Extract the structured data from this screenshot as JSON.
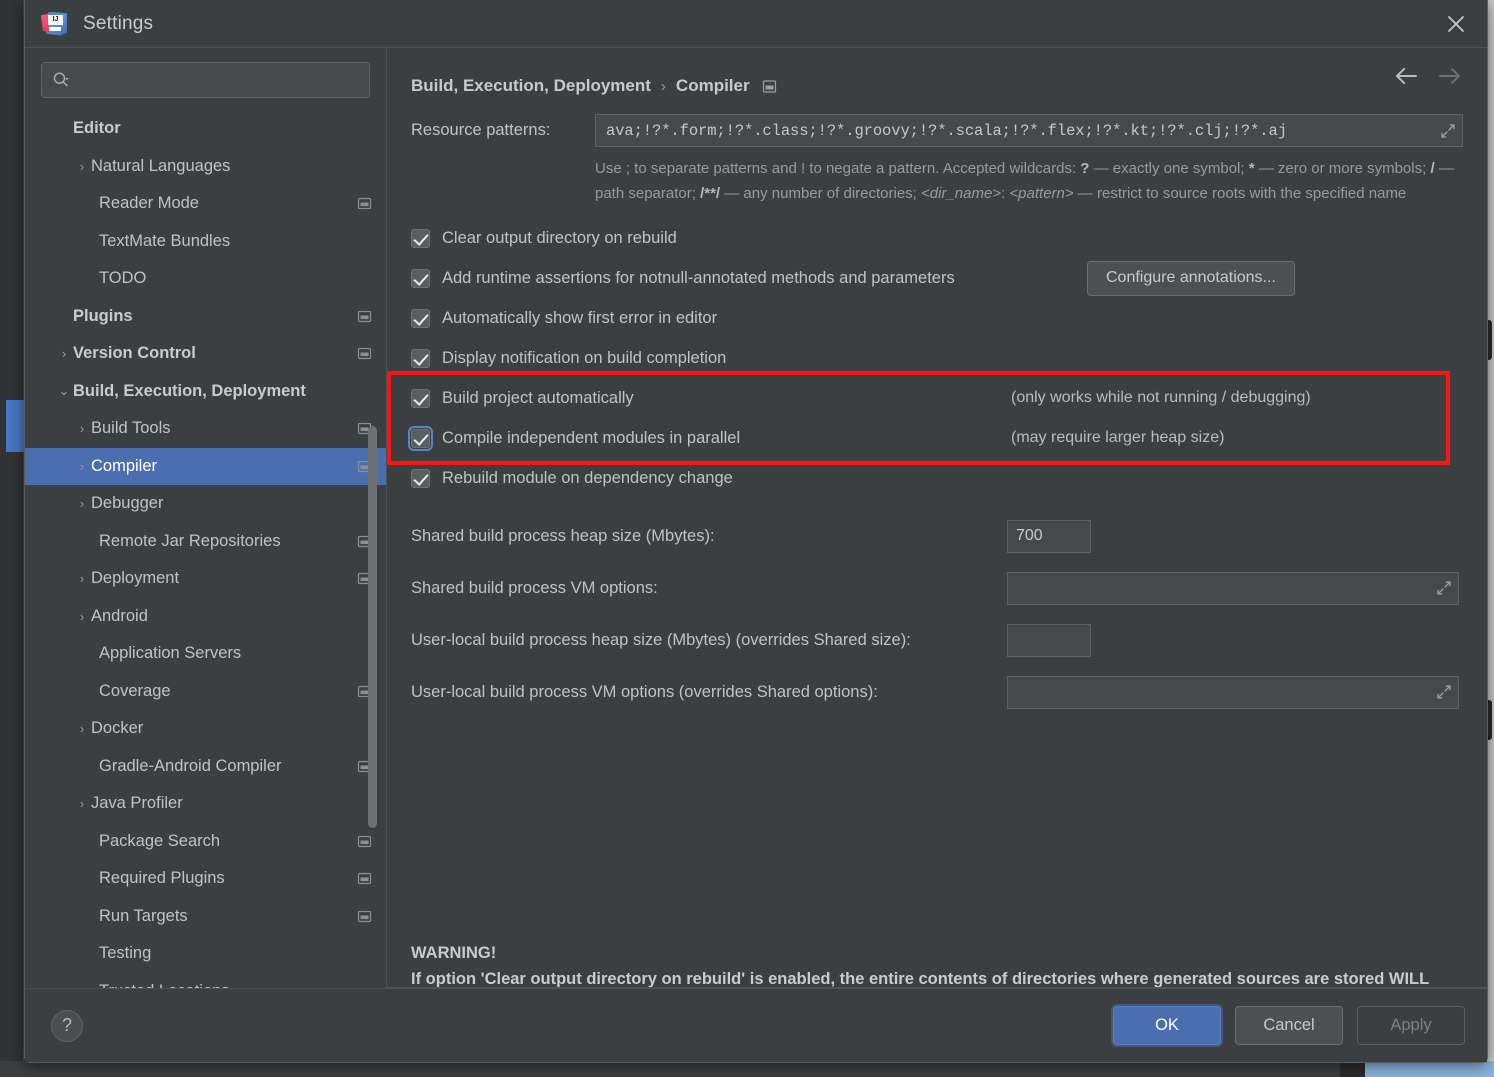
{
  "window": {
    "title": "Settings",
    "logo_text": "IJ",
    "close_icon": "close-icon"
  },
  "sidebar": {
    "search": {
      "value": "",
      "placeholder": ""
    },
    "items": [
      {
        "label": "Editor",
        "indent": 0,
        "bold": true,
        "arrow": "",
        "badge": false,
        "selected": false
      },
      {
        "label": "Natural Languages",
        "indent": 1,
        "bold": false,
        "arrow": "›",
        "badge": false,
        "selected": false
      },
      {
        "label": "Reader Mode",
        "indent": 2,
        "bold": false,
        "arrow": "",
        "badge": true,
        "selected": false
      },
      {
        "label": "TextMate Bundles",
        "indent": 2,
        "bold": false,
        "arrow": "",
        "badge": false,
        "selected": false
      },
      {
        "label": "TODO",
        "indent": 2,
        "bold": false,
        "arrow": "",
        "badge": false,
        "selected": false
      },
      {
        "label": "Plugins",
        "indent": 0,
        "bold": true,
        "arrow": "",
        "badge": true,
        "selected": false
      },
      {
        "label": "Version Control",
        "indent": 0,
        "bold": true,
        "arrow": "›",
        "badge": true,
        "selected": false
      },
      {
        "label": "Build, Execution, Deployment",
        "indent": 0,
        "bold": true,
        "arrow": "⌄",
        "badge": false,
        "selected": false
      },
      {
        "label": "Build Tools",
        "indent": 1,
        "bold": false,
        "arrow": "›",
        "badge": true,
        "selected": false
      },
      {
        "label": "Compiler",
        "indent": 1,
        "bold": false,
        "arrow": "›",
        "badge": true,
        "selected": true
      },
      {
        "label": "Debugger",
        "indent": 1,
        "bold": false,
        "arrow": "›",
        "badge": false,
        "selected": false
      },
      {
        "label": "Remote Jar Repositories",
        "indent": 2,
        "bold": false,
        "arrow": "",
        "badge": true,
        "selected": false
      },
      {
        "label": "Deployment",
        "indent": 1,
        "bold": false,
        "arrow": "›",
        "badge": true,
        "selected": false
      },
      {
        "label": "Android",
        "indent": 1,
        "bold": false,
        "arrow": "›",
        "badge": false,
        "selected": false
      },
      {
        "label": "Application Servers",
        "indent": 2,
        "bold": false,
        "arrow": "",
        "badge": false,
        "selected": false
      },
      {
        "label": "Coverage",
        "indent": 2,
        "bold": false,
        "arrow": "",
        "badge": true,
        "selected": false
      },
      {
        "label": "Docker",
        "indent": 1,
        "bold": false,
        "arrow": "›",
        "badge": false,
        "selected": false
      },
      {
        "label": "Gradle-Android Compiler",
        "indent": 2,
        "bold": false,
        "arrow": "",
        "badge": true,
        "selected": false
      },
      {
        "label": "Java Profiler",
        "indent": 1,
        "bold": false,
        "arrow": "›",
        "badge": false,
        "selected": false
      },
      {
        "label": "Package Search",
        "indent": 2,
        "bold": false,
        "arrow": "",
        "badge": true,
        "selected": false
      },
      {
        "label": "Required Plugins",
        "indent": 2,
        "bold": false,
        "arrow": "",
        "badge": true,
        "selected": false
      },
      {
        "label": "Run Targets",
        "indent": 2,
        "bold": false,
        "arrow": "",
        "badge": true,
        "selected": false
      },
      {
        "label": "Testing",
        "indent": 2,
        "bold": false,
        "arrow": "",
        "badge": false,
        "selected": false
      },
      {
        "label": "Trusted Locations",
        "indent": 2,
        "bold": false,
        "arrow": "",
        "badge": false,
        "selected": false
      }
    ]
  },
  "main": {
    "breadcrumb": {
      "parent": "Build, Execution, Deployment",
      "separator": "›",
      "current": "Compiler"
    },
    "nav": {
      "back_icon": "arrow-left-icon",
      "forward_icon": "arrow-right-icon"
    },
    "resource_patterns": {
      "label": "Resource patterns:",
      "value": "ava;!?*.form;!?*.class;!?*.groovy;!?*.scala;!?*.flex;!?*.kt;!?*.clj;!?*.aj",
      "hint_line1_a": "Use ; to separate patterns and ! to negate a pattern. Accepted wildcards: ",
      "hint_q": "?",
      "hint_line1_b": " — exactly one symbol; ",
      "hint_star": "*",
      "hint_line1_c": " — zero or more symbols; ",
      "hint_slash": "/",
      "hint_line2_a": " — path separator; ",
      "hint_globstar": "/**/",
      "hint_line2_b": " — any number of directories;  ",
      "hint_dirname": "<dir_name>",
      "hint_colon": ": ",
      "hint_pattern": "<pattern>",
      "hint_line2_c": " — restrict to source roots with the specified name"
    },
    "checkboxes": [
      {
        "label": "Clear output directory on rebuild",
        "checked": true,
        "focused": false,
        "note": ""
      },
      {
        "label": "Add runtime assertions for notnull-annotated methods and parameters",
        "checked": true,
        "focused": false,
        "note": ""
      },
      {
        "label": "Automatically show first error in editor",
        "checked": true,
        "focused": false,
        "note": ""
      },
      {
        "label": "Display notification on build completion",
        "checked": true,
        "focused": false,
        "note": ""
      },
      {
        "label": "Build project automatically",
        "checked": true,
        "focused": false,
        "note": "(only works while not running / debugging)"
      },
      {
        "label": "Compile independent modules in parallel",
        "checked": true,
        "focused": true,
        "note": "(may require larger heap size)"
      },
      {
        "label": "Rebuild module on dependency change",
        "checked": true,
        "focused": false,
        "note": ""
      }
    ],
    "configure_annotations_button": "Configure annotations...",
    "fields": [
      {
        "label": "Shared build process heap size (Mbytes):",
        "value": "700",
        "kind": "small"
      },
      {
        "label": "Shared build process VM options:",
        "value": "",
        "kind": "wide"
      },
      {
        "label": "User-local build process heap size (Mbytes) (overrides Shared size):",
        "value": "",
        "kind": "small"
      },
      {
        "label": "User-local build process VM options (overrides Shared options):",
        "value": "",
        "kind": "wide"
      }
    ],
    "warning": {
      "title": "WARNING!",
      "body": "If option 'Clear output directory on rebuild' is enabled, the entire contents of directories where generated sources are stored WILL BE CLEARED on rebuild."
    }
  },
  "footer": {
    "help_label": "?",
    "ok_label": "OK",
    "cancel_label": "Cancel",
    "apply_label": "Apply"
  },
  "colors": {
    "dialog_bg": "#3c3f41",
    "selection_blue": "#4b6eaf",
    "highlight_red": "#ff1414",
    "text_primary": "#bfc3c7",
    "text_muted": "#9a9a9a"
  }
}
